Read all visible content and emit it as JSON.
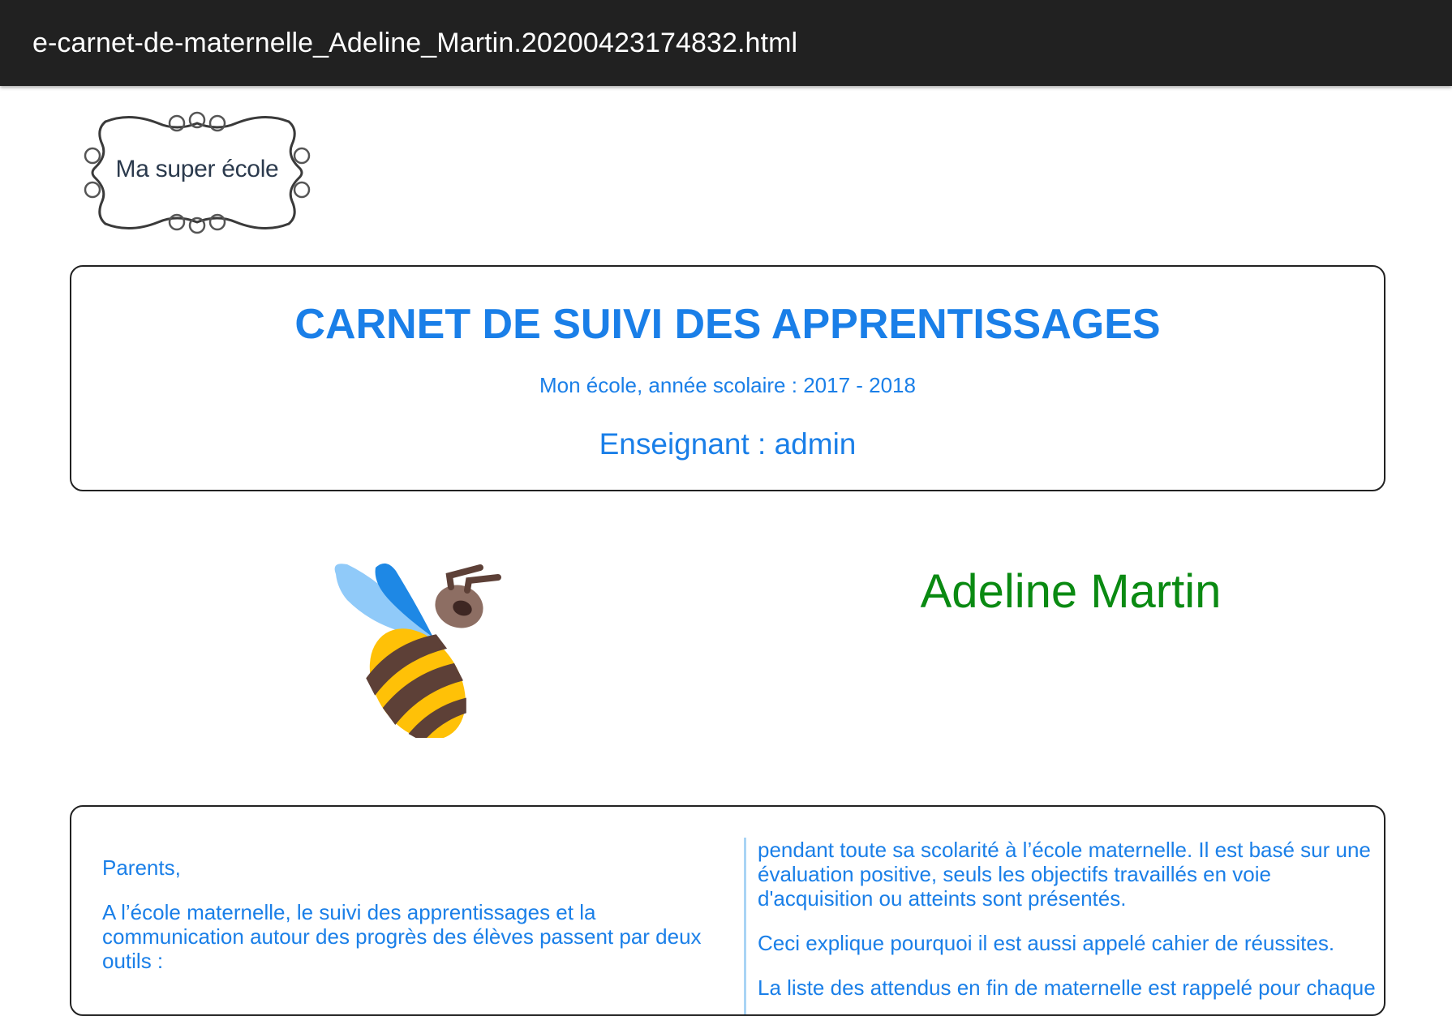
{
  "window": {
    "title": "e-carnet-de-maternelle_Adeline_Martin.20200423174832.html"
  },
  "logo": {
    "text": "Ma super école",
    "icon": "ornate-frame-logo"
  },
  "header": {
    "title": "CARNET DE SUIVI DES APPRENTISSAGES",
    "subtitle": "Mon école, année scolaire : 2017 - 2018",
    "teacher": "Enseignant : admin"
  },
  "student": {
    "name": "Adeline Martin",
    "icon": "bee-icon"
  },
  "intro": {
    "left": {
      "greeting": "Parents,",
      "paragraph1": "A l’école maternelle, le suivi des apprentissages et la communication autour des progrès des élèves passent par deux outils :"
    },
    "right": {
      "paragraph1": "pendant toute sa scolarité à l’école maternelle. Il est basé sur une évaluation positive, seuls les objectifs travaillés en voie d'acquisition ou atteints sont présentés.",
      "paragraph2": "Ceci explique pourquoi il est aussi appelé cahier de réussites.",
      "paragraph3": "La liste des attendus en fin de maternelle est rappelé pour chaque"
    }
  },
  "colors": {
    "topbar": "#212121",
    "title_blue": "#1a7fe8",
    "name_green": "#0a8a12",
    "divider": "#a9d4f5"
  }
}
